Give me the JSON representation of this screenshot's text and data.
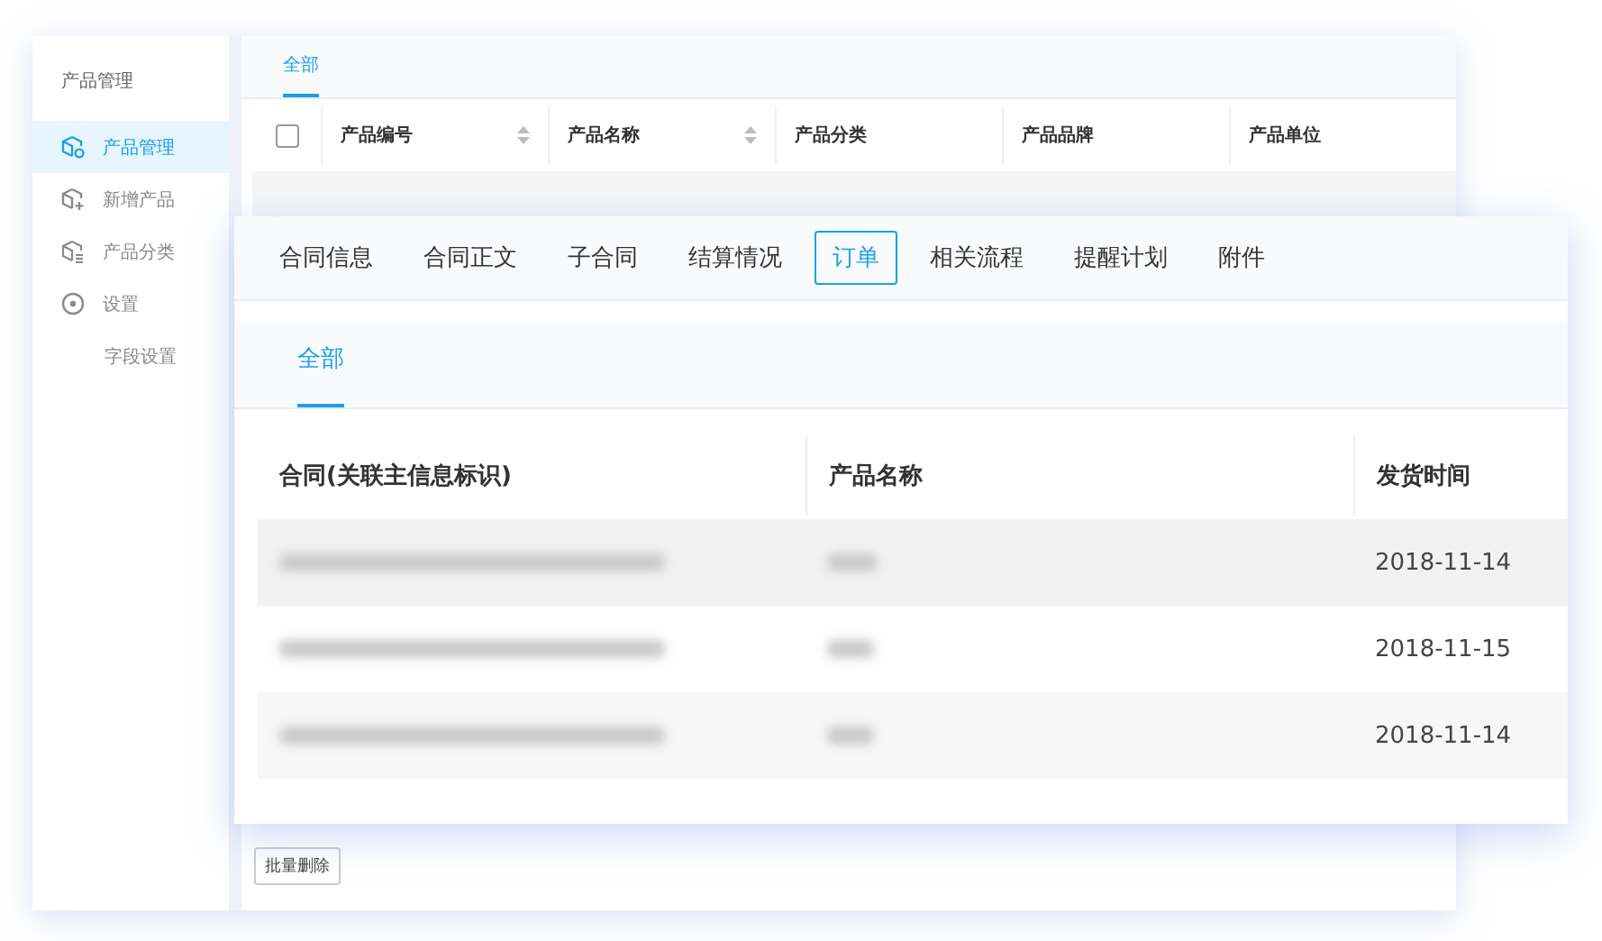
{
  "sidebar": {
    "title": "产品管理",
    "items": [
      {
        "label": "产品管理",
        "kind": "item",
        "selected": true
      },
      {
        "label": "新增产品",
        "kind": "item",
        "selected": false
      },
      {
        "label": "产品分类",
        "kind": "item",
        "selected": false
      },
      {
        "label": "设置",
        "kind": "item",
        "selected": false
      },
      {
        "label": "字段设置",
        "kind": "subitem",
        "selected": false
      }
    ]
  },
  "product_page": {
    "tabs": [
      {
        "label": "全部",
        "selected": true
      }
    ],
    "columns": [
      {
        "label": "产品编号",
        "sortable": true
      },
      {
        "label": "产品名称",
        "sortable": true
      },
      {
        "label": "产品分类",
        "sortable": false
      },
      {
        "label": "产品品牌",
        "sortable": false
      },
      {
        "label": "产品单位",
        "sortable": false
      }
    ],
    "select_all_checked": false,
    "bulk_delete": "批量删除"
  },
  "contract_panel": {
    "tabs": [
      {
        "label": "合同信息",
        "selected": false
      },
      {
        "label": "合同正文",
        "selected": false
      },
      {
        "label": "子合同",
        "selected": false
      },
      {
        "label": "结算情况",
        "selected": false
      },
      {
        "label": "订单",
        "selected": true
      },
      {
        "label": "相关流程",
        "selected": false
      },
      {
        "label": "提醒计划",
        "selected": false
      },
      {
        "label": "附件",
        "selected": false
      }
    ],
    "subtabs": [
      {
        "label": "全部",
        "selected": true
      }
    ],
    "columns": [
      "合同(关联主信息标识)",
      "产品名称",
      "发货时间"
    ],
    "rows": [
      {
        "ship_date": "2018-11-14"
      },
      {
        "ship_date": "2018-11-15"
      },
      {
        "ship_date": "2018-11-14"
      }
    ]
  }
}
